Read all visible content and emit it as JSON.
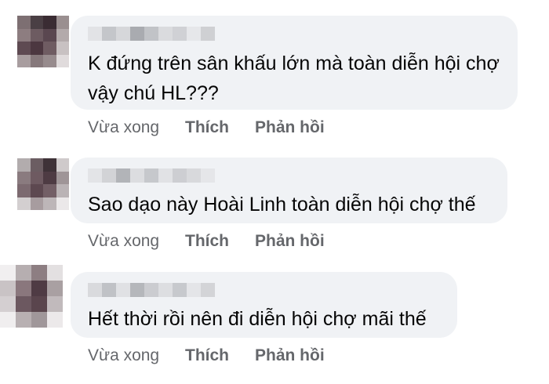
{
  "comments": [
    {
      "text": "K đứng trên sân khấu lớn mà toàn diễn hội chợ\nvậy chú HL???",
      "time": "Vừa xong",
      "like_label": "Thích",
      "reply_label": "Phản hồi"
    },
    {
      "text": "Sao dạo này Hoài Linh toàn diễn hội chợ thế",
      "time": "Vừa xong",
      "like_label": "Thích",
      "reply_label": "Phản hồi"
    },
    {
      "text": "Hết thời rồi nên đi diễn hội chợ mãi thế",
      "time": "Vừa xong",
      "like_label": "Thích",
      "reply_label": "Phản hồi"
    }
  ],
  "colors": {
    "bubble_bg": "#f0f2f5",
    "text": "#050505",
    "meta": "#65676b"
  }
}
